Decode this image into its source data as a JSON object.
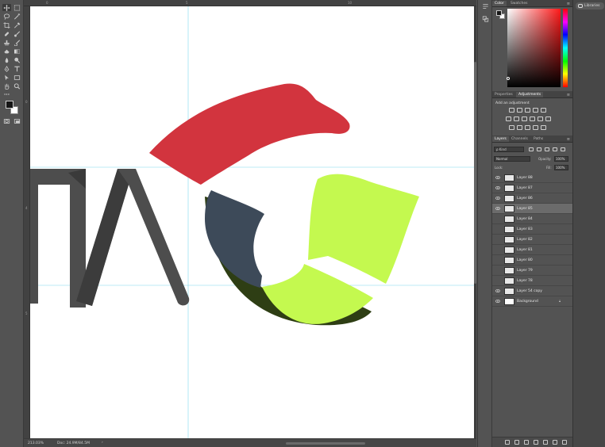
{
  "status": {
    "zoom": "213.03%",
    "doc": "Doc: 24.9M/84.5M",
    "arrow": "›"
  },
  "rulers": {
    "top": [
      "0",
      "5",
      "10"
    ],
    "left": [
      "0",
      "4",
      "5"
    ]
  },
  "panels": {
    "color": {
      "tabs": [
        "Color",
        "Swatches"
      ]
    },
    "adjustments": {
      "tabs": [
        "Properties",
        "Adjustments"
      ],
      "title": "Add an adjustment"
    },
    "layers": {
      "tabs": [
        "Layers",
        "Channels",
        "Paths"
      ],
      "kind_filter": "ρ Kind",
      "blend_mode": "Normal",
      "opacity_label": "Opacity:",
      "opacity_value": "100%",
      "lock_label": "Lock:",
      "fill_label": "Fill:",
      "fill_value": "100%",
      "items": [
        {
          "name": "Layer 88",
          "visible": true,
          "selected": false
        },
        {
          "name": "Layer 87",
          "visible": true,
          "selected": false
        },
        {
          "name": "Layer 86",
          "visible": true,
          "selected": false
        },
        {
          "name": "Layer 85",
          "visible": true,
          "selected": true
        },
        {
          "name": "Layer 84",
          "visible": false,
          "selected": false
        },
        {
          "name": "Layer 83",
          "visible": false,
          "selected": false
        },
        {
          "name": "Layer 82",
          "visible": false,
          "selected": false
        },
        {
          "name": "Layer 81",
          "visible": false,
          "selected": false
        },
        {
          "name": "Layer 80",
          "visible": false,
          "selected": false
        },
        {
          "name": "Layer 79",
          "visible": false,
          "selected": false
        },
        {
          "name": "Layer 78",
          "visible": false,
          "selected": false
        },
        {
          "name": "Layer 54 copy",
          "visible": true,
          "selected": false
        },
        {
          "name": "Background",
          "visible": true,
          "selected": false,
          "locked": true
        }
      ]
    }
  },
  "libraries": {
    "label": "Libraries"
  },
  "colors": {
    "red_shape": "#d2343e",
    "dark_gray": "#4d4d4d",
    "slate": "#3d4a59",
    "dark_green": "#2e3e14",
    "lime": "#c4f94f",
    "guide": "#7fd8ee"
  },
  "icons": {
    "toolbar": [
      "move-icon",
      "marquee-icon",
      "lasso-icon",
      "magic-wand-icon",
      "crop-icon",
      "eyedropper-icon",
      "healing-icon",
      "brush-icon",
      "stamp-icon",
      "history-brush-icon",
      "eraser-icon",
      "gradient-icon",
      "blur-icon",
      "dodge-icon",
      "pen-icon",
      "type-icon",
      "path-select-icon",
      "shape-icon",
      "hand-icon",
      "zoom-icon",
      "more-icon",
      "quick-mask-icon",
      "screen-mode-icon"
    ]
  }
}
